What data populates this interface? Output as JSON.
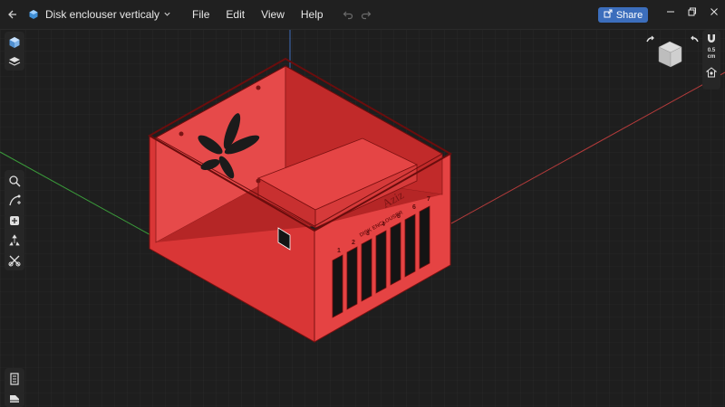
{
  "app": {
    "document_title": "Disk enclouser verticaly",
    "menu": [
      "File",
      "Edit",
      "View",
      "Help"
    ],
    "share_label": "Share"
  },
  "model": {
    "front_logo": "Aziz",
    "front_sub": "DISK ENCLOUSER",
    "slot_numbers": [
      "1",
      "2",
      "3",
      "4",
      "5",
      "6",
      "7"
    ],
    "color": "#e03a3a"
  },
  "snap": {
    "value": "0.5",
    "unit": "cm"
  },
  "colors": {
    "accent": "#3c6ebc",
    "axis_x": "#b43b3b",
    "axis_y": "#3a9a3a",
    "axis_z": "#3f6fbf"
  },
  "icons": [
    "back-icon",
    "app-logo-icon",
    "chevron-down-icon",
    "undo-icon",
    "redo-icon",
    "share-icon",
    "minimize-icon",
    "maximize-icon",
    "close-icon",
    "component-cube-icon",
    "layers-icon",
    "search-icon",
    "sketch-icon",
    "add-primitive-icon",
    "transform-icon",
    "modify-icon",
    "timeline-icon",
    "export-icon",
    "magnet-icon",
    "home-view-icon",
    "orbit-left-icon",
    "orbit-right-icon"
  ]
}
